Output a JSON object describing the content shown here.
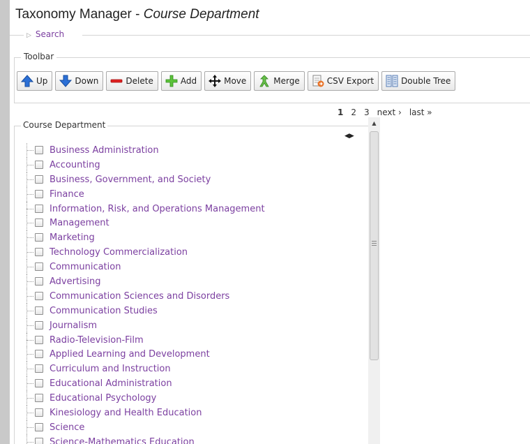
{
  "header": {
    "title_prefix": "Taxonomy Manager - ",
    "title_vocab": "Course Department"
  },
  "search": {
    "label": "Search"
  },
  "toolbar": {
    "legend": "Toolbar",
    "buttons": [
      {
        "label": "Up",
        "icon": "arrow-up-icon"
      },
      {
        "label": "Down",
        "icon": "arrow-down-icon"
      },
      {
        "label": "Delete",
        "icon": "delete-icon"
      },
      {
        "label": "Add",
        "icon": "plus-icon"
      },
      {
        "label": "Move",
        "icon": "move-icon"
      },
      {
        "label": "Merge",
        "icon": "merge-icon"
      },
      {
        "label": "CSV Export",
        "icon": "csv-export-icon"
      },
      {
        "label": "Double Tree",
        "icon": "double-tree-icon"
      }
    ]
  },
  "pager": {
    "pages": [
      "1",
      "2",
      "3"
    ],
    "next": "next ›",
    "last": "last »"
  },
  "tree": {
    "legend": "Course Department",
    "items": [
      "Business Administration",
      "Accounting",
      "Business, Government, and Society",
      "Finance",
      "Information, Risk, and Operations Management",
      "Management",
      "Marketing",
      "Technology Commercialization",
      "Communication",
      "Advertising",
      "Communication Sciences and Disorders",
      "Communication Studies",
      "Journalism",
      "Radio-Television-Film",
      "Applied Learning and Development",
      "Curriculum and Instruction",
      "Educational Administration",
      "Educational Psychology",
      "Kinesiology and Health Education",
      "Science",
      "Science-Mathematics Education"
    ]
  },
  "colors": {
    "link": "#7b3fa0",
    "background": "#c9c9c9"
  }
}
